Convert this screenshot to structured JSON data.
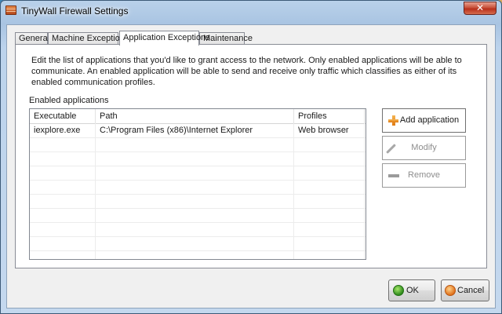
{
  "window": {
    "title": "TinyWall Firewall Settings",
    "close_glyph": "✕"
  },
  "tabs": [
    {
      "label": "General",
      "active": false
    },
    {
      "label": "Machine Exceptions",
      "active": false
    },
    {
      "label": "Application Exceptions",
      "active": true
    },
    {
      "label": "Maintenance",
      "active": false
    }
  ],
  "page": {
    "description": "Edit the list of applications that you'd like to grant access to the network. Only enabled applications will be able to communicate.  An enabled application will be able to send and receive only traffic which classifies as either of its enabled communication profiles.",
    "group_label": "Enabled applications"
  },
  "table": {
    "columns": [
      "Executable",
      "Path",
      "Profiles"
    ],
    "rows": [
      {
        "executable": "iexplore.exe",
        "path": "C:\\Program Files (x86)\\Internet Explorer",
        "profiles": "Web browser"
      }
    ]
  },
  "buttons": {
    "add": "Add application",
    "modify": "Modify",
    "remove": "Remove",
    "ok": "OK",
    "cancel": "Cancel"
  },
  "icons": {
    "app": "firewall-icon",
    "add": "plus-icon",
    "modify": "pencil-icon",
    "remove": "minus-icon",
    "ok": "green-circle-icon",
    "cancel": "orange-circle-icon"
  },
  "colors": {
    "close_button": "#c8513b",
    "add_icon": "#e07a12",
    "ok_icon": "#2f8a1c",
    "cancel_icon": "#e0721c"
  }
}
